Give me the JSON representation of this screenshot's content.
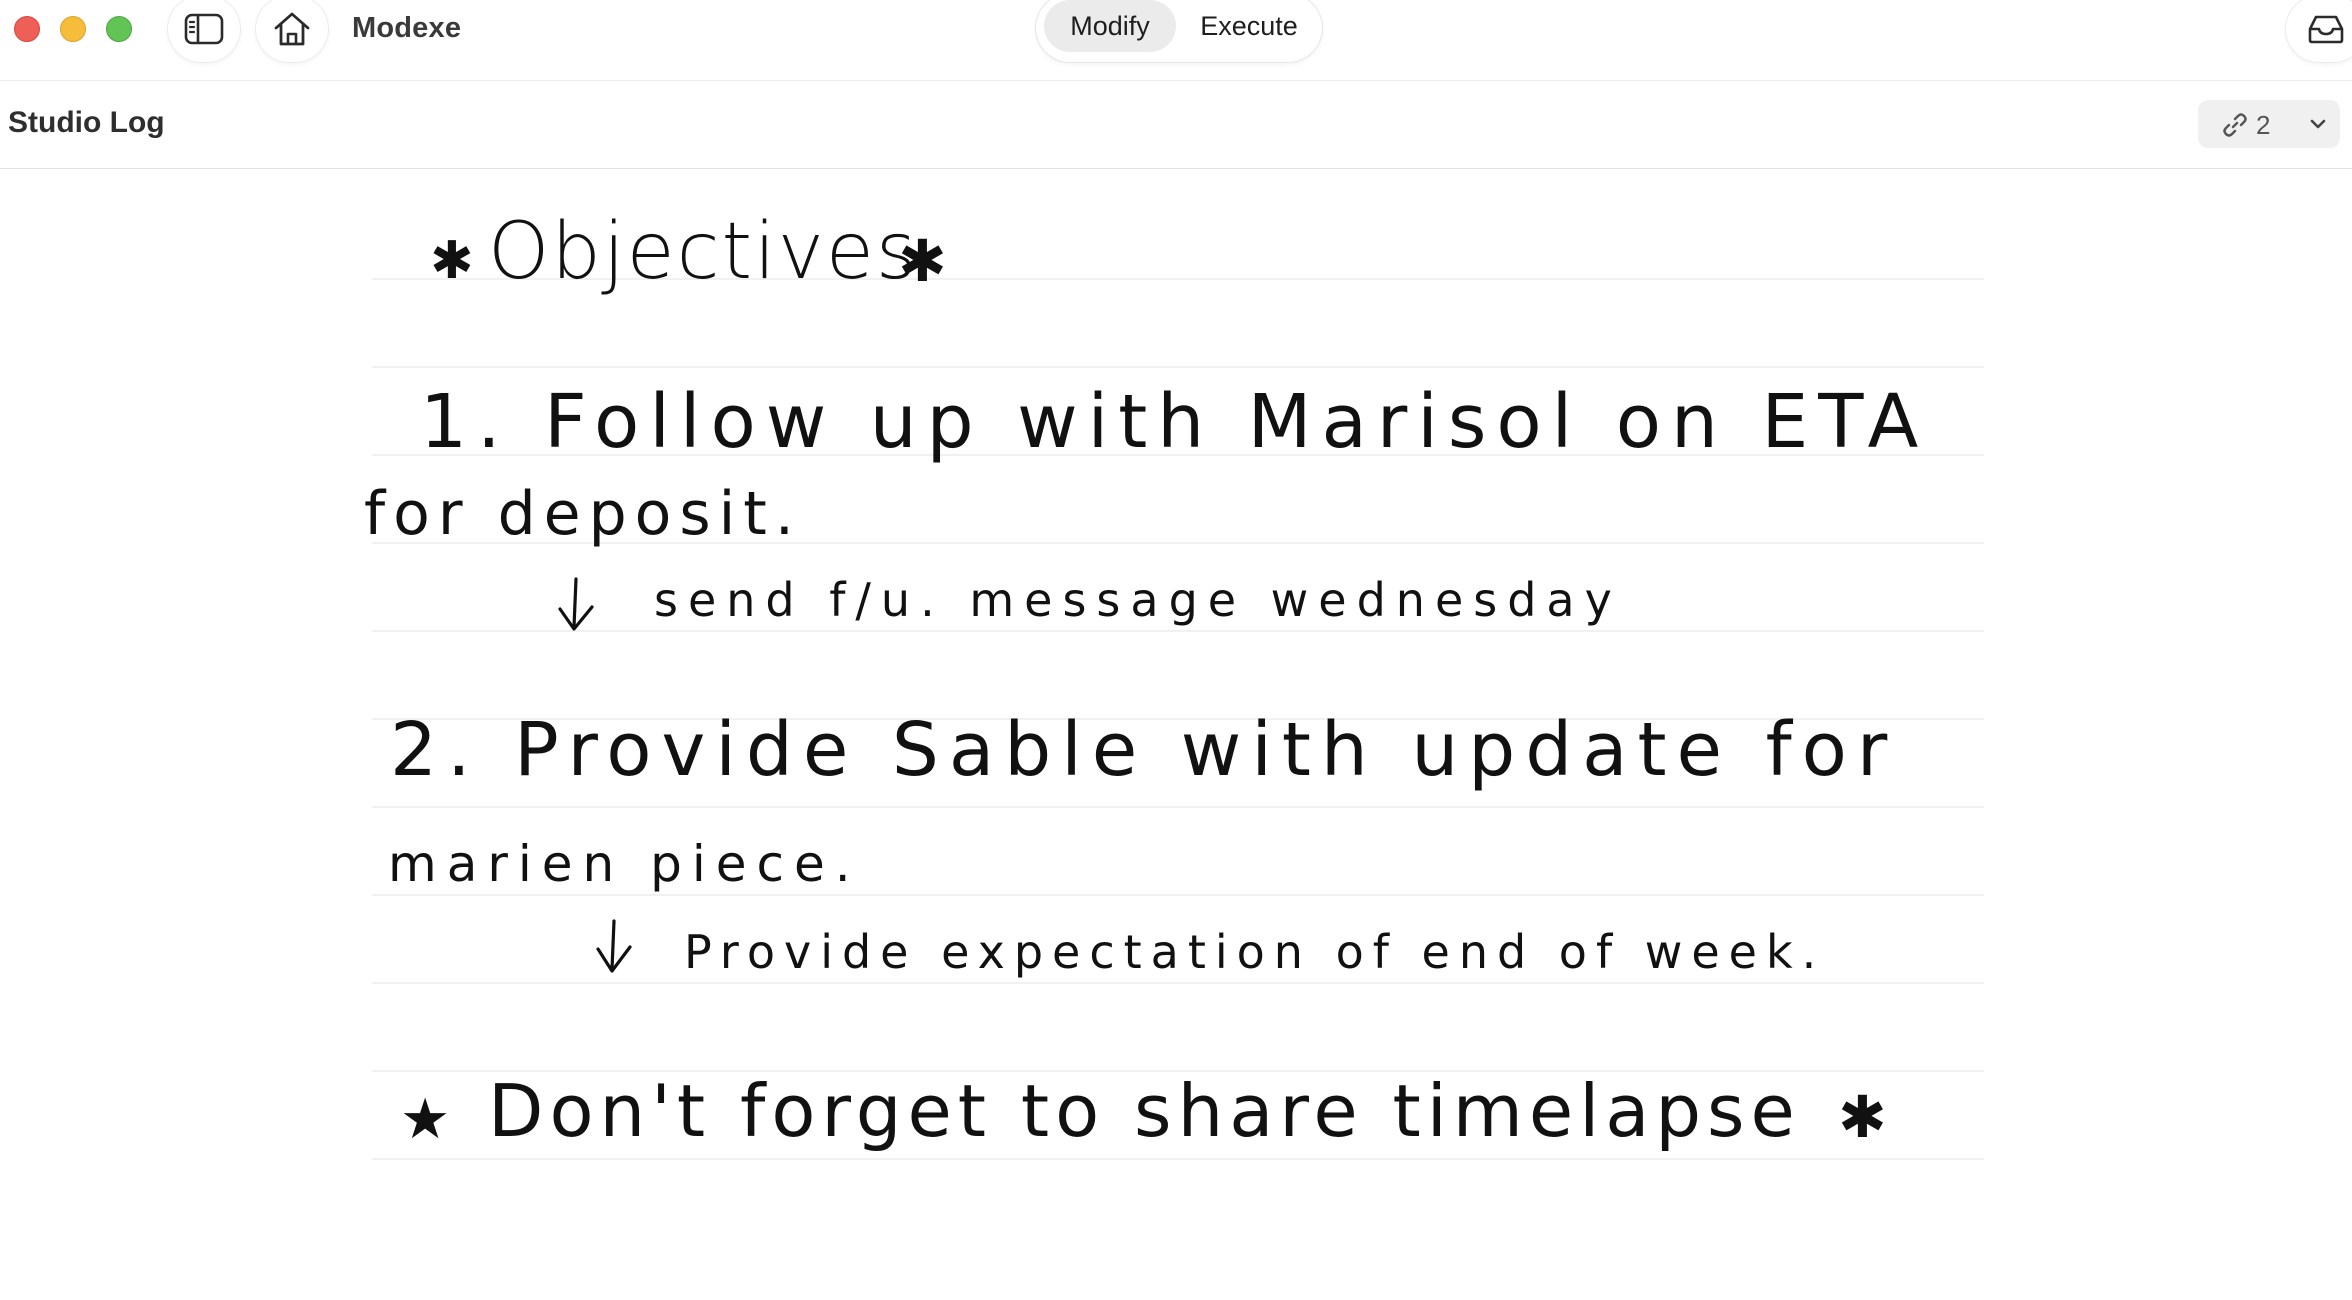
{
  "window": {
    "app_title": "Modexe",
    "modes": {
      "modify_label": "Modify",
      "execute_label": "Execute",
      "active": "Modify"
    },
    "icons": {
      "sidebar": "sidebar-toggle-icon",
      "home": "home-icon",
      "inbox": "inbox-icon"
    }
  },
  "document": {
    "title": "Studio Log",
    "links_count": "2",
    "link_icon": "link-icon",
    "menu_icon": "chevron-down-icon"
  },
  "note": {
    "heading": "Objectives",
    "item1_line1": "1. Follow up with Marisol on ETA",
    "item1_line2": "for deposit.",
    "item1_sub": "send f/u. message wednesday",
    "item2_line1": "2. Provide Sable with update for",
    "item2_line2": "marien piece.",
    "item2_sub": "Provide expectation of end of week.",
    "reminder": "Don't forget to share timelapse"
  }
}
